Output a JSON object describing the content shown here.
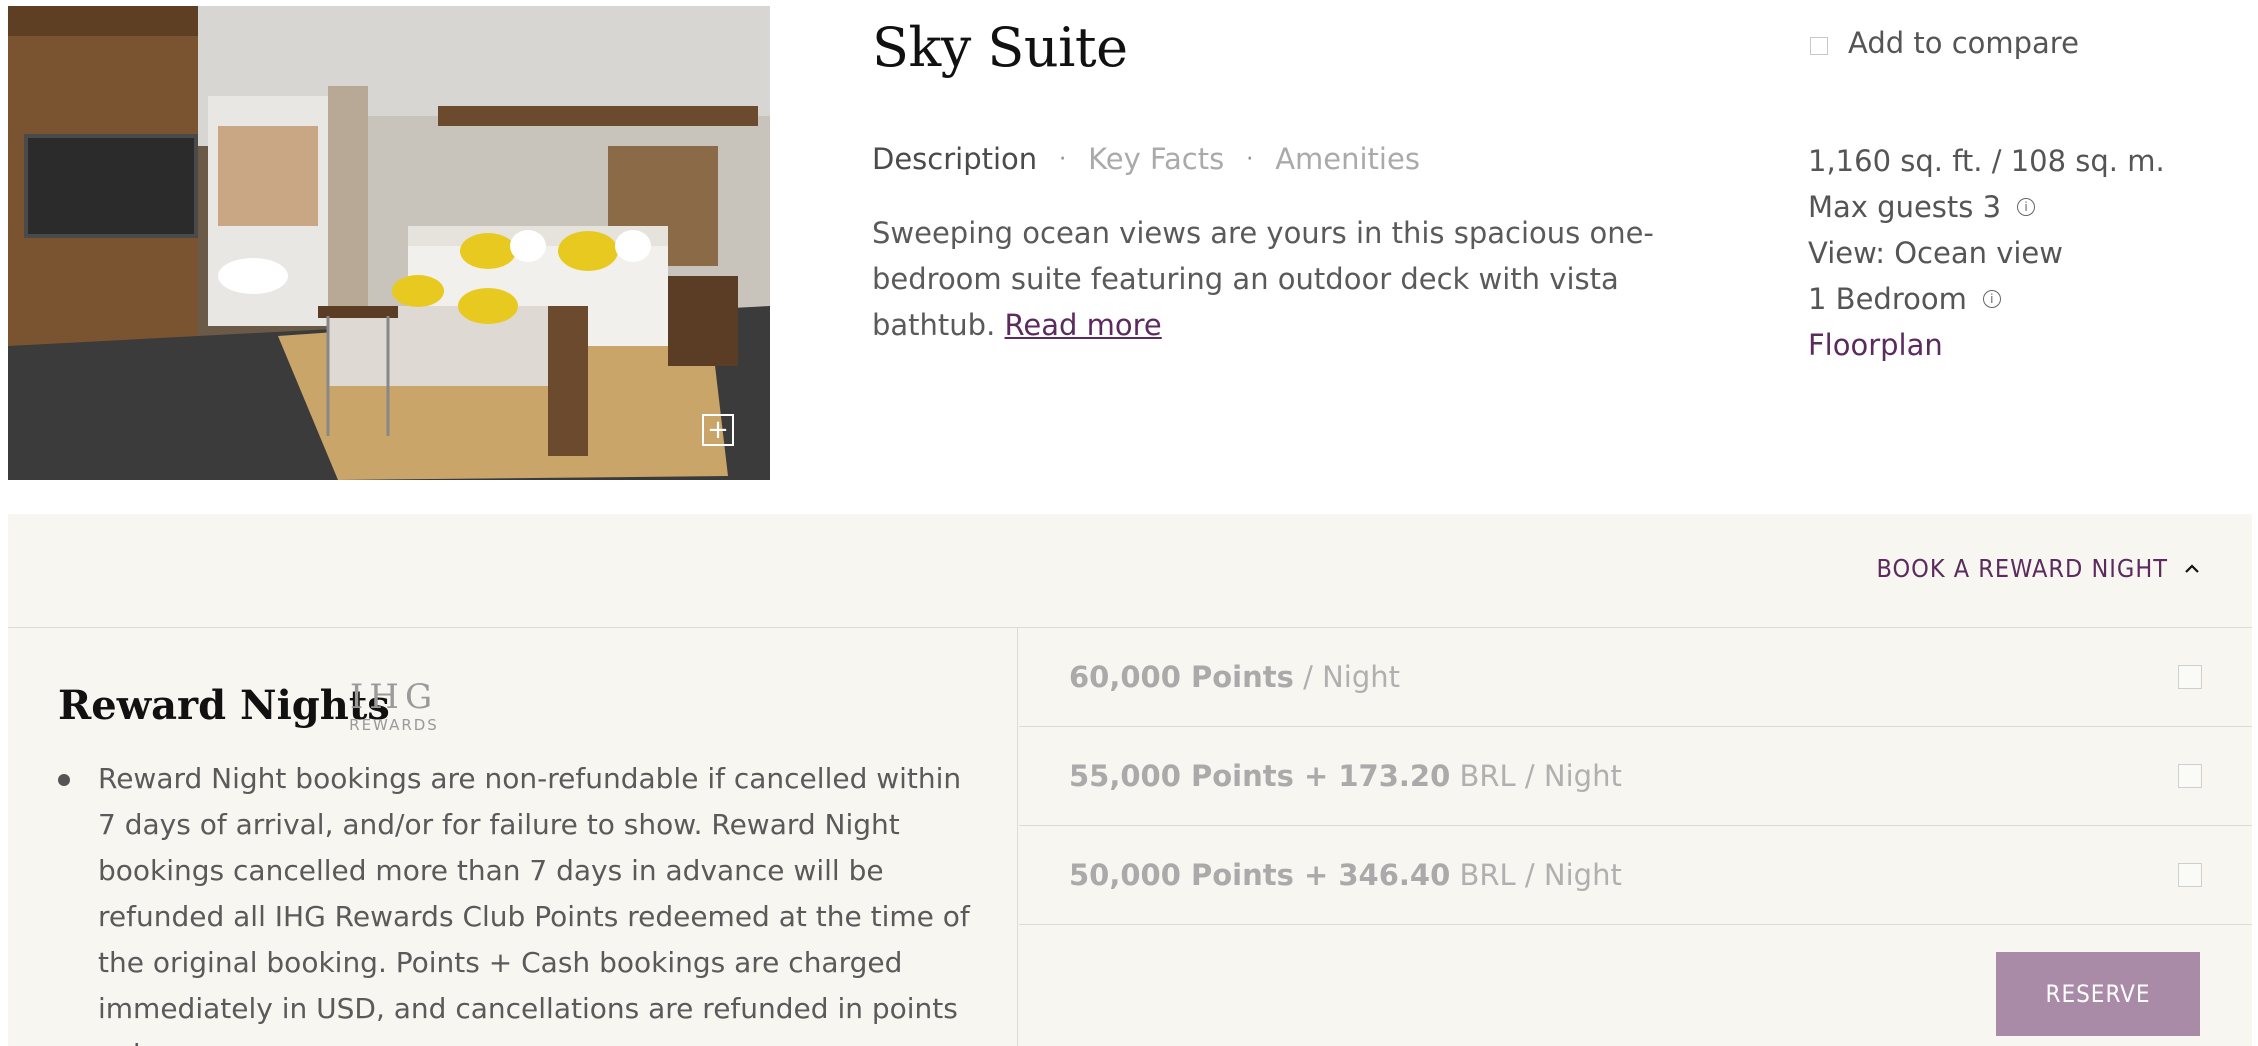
{
  "room": {
    "title": "Sky Suite",
    "compare_label": "Add to compare",
    "tabs": [
      {
        "label": "Description",
        "active": true
      },
      {
        "label": "Key Facts",
        "active": false
      },
      {
        "label": "Amenities",
        "active": false
      }
    ],
    "tab_separator": "·",
    "description": "Sweeping ocean views are yours in this spacious one-bedroom suite featuring an outdoor deck with vista bathtub.",
    "read_more": "Read more",
    "facts": {
      "size": "1,160 sq. ft. / 108 sq. m.",
      "max_guests": "Max guests 3",
      "view": "View: Ocean view",
      "bedrooms": "1 Bedroom",
      "floorplan": "Floorplan"
    },
    "info_icon": "ⓘ",
    "expand_icon": "+"
  },
  "reward_panel": {
    "toggle_label": "BOOK A REWARD NIGHT",
    "title": "Reward Nights",
    "logo": {
      "line1": "IHG",
      "line2": "REWARDS"
    },
    "policy": "Reward Night bookings are non-refundable if cancelled within 7 days of arrival, and/or for failure to show. Reward Night bookings cancelled more than 7 days in advance will be refunded all IHG Rewards Club Points redeemed at the time of the original booking. Points + Cash bookings are charged immediately in USD, and cancellations are refunded in points only.",
    "rates": [
      {
        "bold": "60,000 Points",
        "rest": " / Night"
      },
      {
        "bold": "55,000 Points + 173.20",
        "rest": " BRL / Night"
      },
      {
        "bold": "50,000 Points + 346.40",
        "rest": " BRL / Night"
      }
    ],
    "reserve_label": "RESERVE"
  },
  "colors": {
    "accent": "#5b2b5e",
    "reserve_button": "#a98ba7",
    "panel_bg": "#f7f6f1"
  }
}
